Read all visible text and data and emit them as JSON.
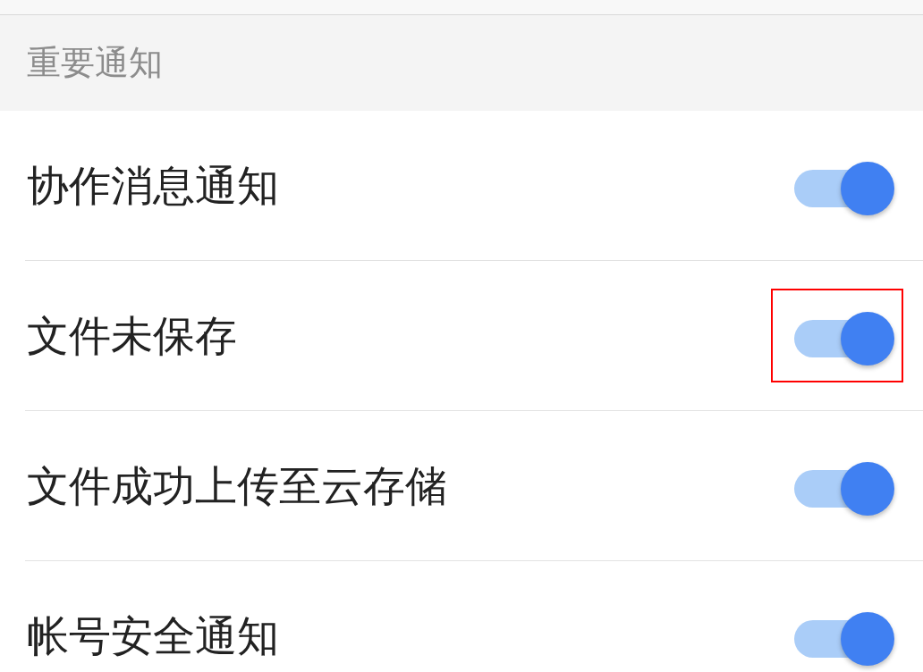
{
  "section": {
    "title": "重要通知"
  },
  "items": [
    {
      "label": "协作消息通知",
      "on": true,
      "highlighted": false
    },
    {
      "label": "文件未保存",
      "on": true,
      "highlighted": true
    },
    {
      "label": "文件成功上传至云存储",
      "on": true,
      "highlighted": false
    },
    {
      "label": "帐号安全通知",
      "on": true,
      "highlighted": false
    }
  ]
}
